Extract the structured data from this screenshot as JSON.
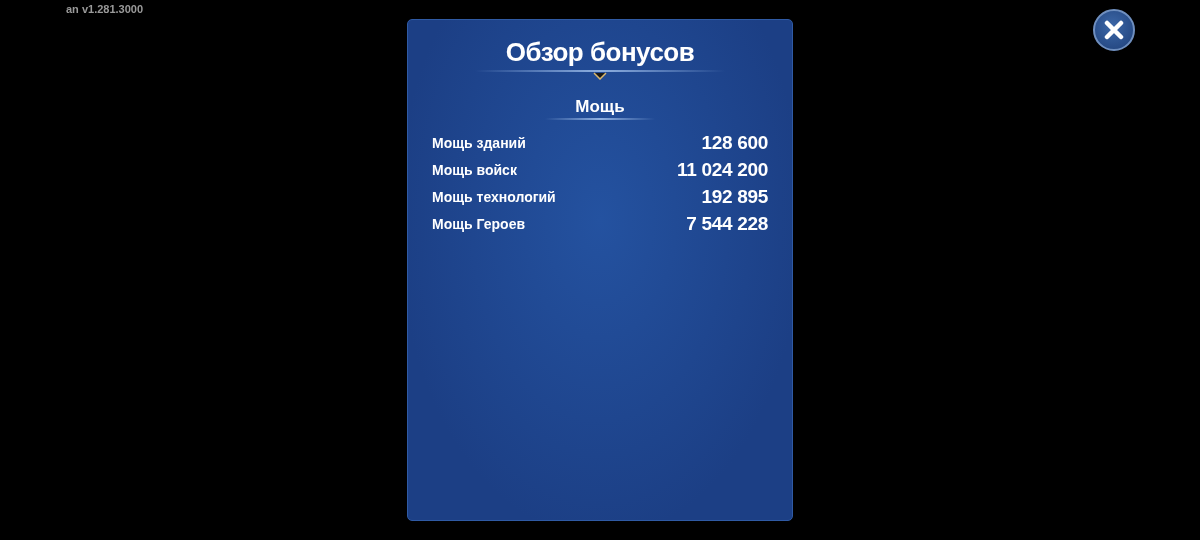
{
  "version": "an v1.281.3000",
  "dialog": {
    "title": "Обзор бонусов",
    "section": "Мощь",
    "rows": [
      {
        "label": "Мощь зданий",
        "value": "128 600"
      },
      {
        "label": "Мощь войск",
        "value": "11 024 200"
      },
      {
        "label": "Мощь технологий",
        "value": "192 895"
      },
      {
        "label": "Мощь Героев",
        "value": "7 544 228"
      }
    ]
  }
}
